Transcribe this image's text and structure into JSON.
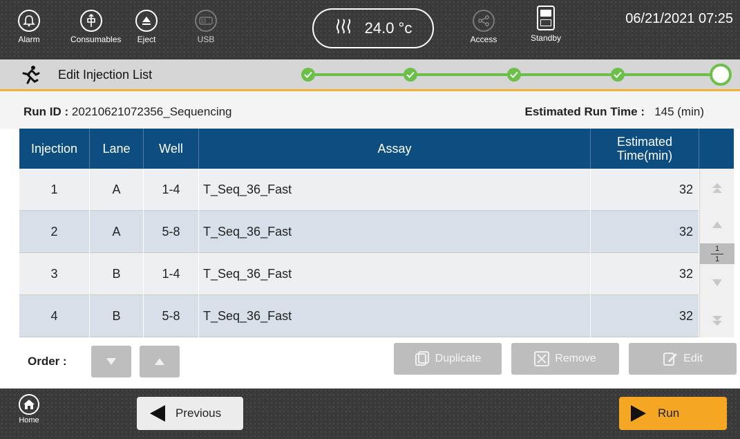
{
  "topbar": {
    "buttons": [
      {
        "label": "Alarm",
        "icon": "bell-icon"
      },
      {
        "label": "Consumables",
        "icon": "consumables-icon"
      },
      {
        "label": "Eject",
        "icon": "eject-icon"
      },
      {
        "label": "USB",
        "icon": "usb-icon"
      },
      {
        "label": "Access",
        "icon": "share-icon"
      },
      {
        "label": "Standby",
        "icon": "standby-icon"
      }
    ],
    "temperature": "24.0 °c",
    "datetime": "06/21/2021 07:25"
  },
  "step": {
    "title": "Edit Injection List",
    "completed_steps": 4,
    "total_steps": 5
  },
  "run": {
    "run_id_label": "Run ID :",
    "run_id": "20210621072356_Sequencing",
    "est_label": "Estimated Run Time :",
    "est_value": "145 (min)"
  },
  "table": {
    "headers": [
      "Injection",
      "Lane",
      "Well",
      "Assay",
      "Estimated Time(min)"
    ],
    "rows": [
      {
        "injection": "1",
        "lane": "A",
        "well": "1-4",
        "assay": "T_Seq_36_Fast",
        "time": "32"
      },
      {
        "injection": "2",
        "lane": "A",
        "well": "5-8",
        "assay": "T_Seq_36_Fast",
        "time": "32"
      },
      {
        "injection": "3",
        "lane": "B",
        "well": "1-4",
        "assay": "T_Seq_36_Fast",
        "time": "32"
      },
      {
        "injection": "4",
        "lane": "B",
        "well": "5-8",
        "assay": "T_Seq_36_Fast",
        "time": "32"
      }
    ],
    "page_current": "1",
    "page_total": "1"
  },
  "actions": {
    "order_label": "Order :",
    "duplicate": "Duplicate",
    "remove": "Remove",
    "edit": "Edit"
  },
  "footer": {
    "home": "Home",
    "previous": "Previous",
    "run": "Run"
  },
  "colors": {
    "header_blue": "#0d4d80",
    "progress_green": "#6cc04a",
    "run_orange": "#f5a623",
    "accent_line": "#f2b233"
  }
}
